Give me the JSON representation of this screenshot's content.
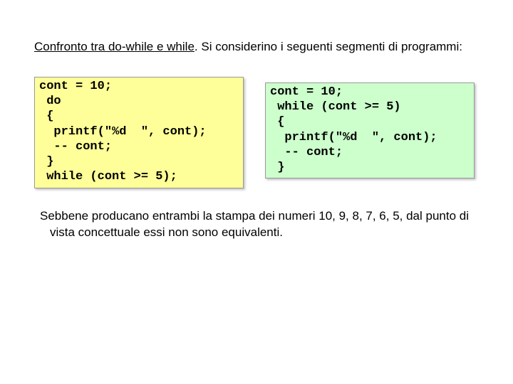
{
  "heading": {
    "underlined": "Confronto tra do-while e while",
    "rest": ". Si considerino i seguenti segmenti di programmi:"
  },
  "code_left": "cont = 10;\n do\n {\n  printf(\"%d  \", cont);\n  -- cont;\n }\n while (cont >= 5);",
  "code_right": "cont = 10;\n while (cont >= 5)\n {\n  printf(\"%d  \", cont);\n  -- cont;\n }",
  "paragraph": "Sebbene producano entrambi la stampa dei numeri 10, 9, 8, 7, 6, 5, dal punto di vista concettuale essi non sono equivalenti."
}
